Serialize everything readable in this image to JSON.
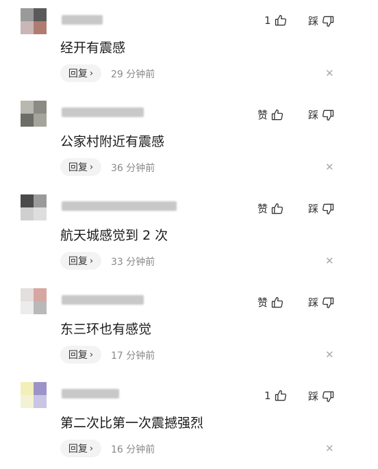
{
  "labels": {
    "reply": "回复",
    "dislike": "踩"
  },
  "comments": [
    {
      "like_label": "1",
      "text": "经开有震感",
      "time": "29 分钟前"
    },
    {
      "like_label": "赞",
      "text": "公家村附近有震感",
      "time": "36 分钟前"
    },
    {
      "like_label": "赞",
      "text": "航天城感觉到 2 次",
      "time": "33 分钟前"
    },
    {
      "like_label": "赞",
      "text": "东三环也有感觉",
      "time": "17 分钟前"
    },
    {
      "like_label": "1",
      "text": "第二次比第一次震撼强烈",
      "time": "16 分钟前"
    }
  ],
  "icons": {
    "like": "thumbs-up-icon",
    "dislike": "thumbs-down-icon",
    "reply": "chevron-right-icon",
    "close": "close-icon"
  }
}
